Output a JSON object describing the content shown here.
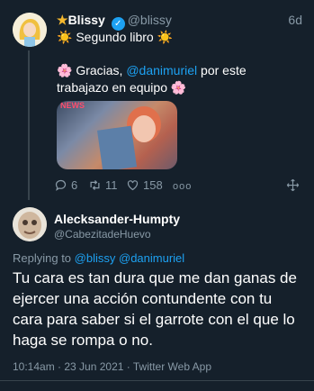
{
  "tweet": {
    "author_name": "Blissy",
    "author_handle": "@blissy",
    "name_prefix": "★",
    "time": "6d",
    "line1": "☀️ Segundo libro ☀️",
    "line2_before": "🌸 Gracias, ",
    "line2_mention": "@danimuriel",
    "line2_after": " por este trabajazo en equipo 🌸",
    "media_badge": "NEWS",
    "replies": "6",
    "retweets": "11",
    "likes": "158",
    "more": "ooo"
  },
  "reply": {
    "author_name": "Alecksander-Humpty",
    "author_handle": "@CabezitadeHuevo",
    "replying_to_label": "Replying to",
    "replying_to_1": "@blissy",
    "replying_to_2": "@danimuriel",
    "text": "Tu cara es tan dura que me dan ganas de ejercer una acción contundente con tu cara para saber si el garrote con el que lo haga se rompa o no.",
    "meta": "10:14am · 23 Jun 2021 · Twitter Web App"
  },
  "colors": {
    "background": "#15202b",
    "accent": "#1da1f2",
    "muted": "#8899a6",
    "divider": "#38444d"
  }
}
